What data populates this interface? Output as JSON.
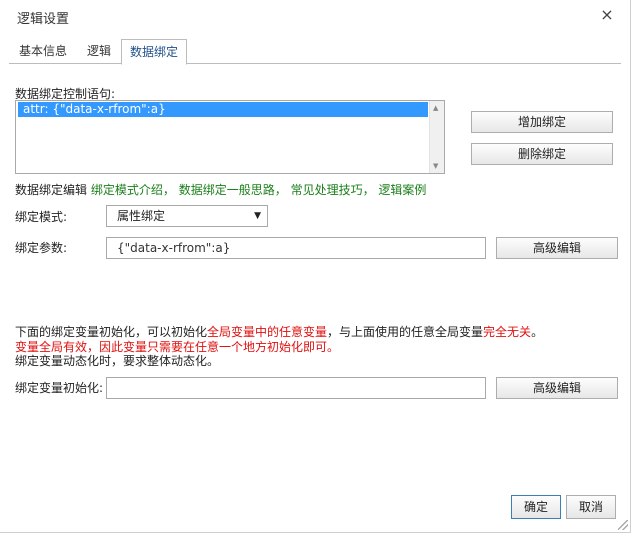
{
  "window": {
    "title": "逻辑设置",
    "close_glyph": "×"
  },
  "tabs": [
    {
      "label": "基本信息",
      "active": false
    },
    {
      "label": "逻辑",
      "active": false
    },
    {
      "label": "数据绑定",
      "active": true
    }
  ],
  "statements": {
    "label": "数据绑定控制语句:",
    "items": [
      "attr: {\"data-x-rfrom\":a}"
    ]
  },
  "buttons": {
    "add_binding": "增加绑定",
    "delete_binding": "删除绑定",
    "advanced_edit_params": "高级编辑",
    "advanced_edit_init": "高级编辑",
    "ok": "确定",
    "cancel": "取消"
  },
  "help": {
    "prefix": "数据绑定编辑",
    "links": [
      "绑定模式介绍",
      "数据绑定一般思路",
      "常见处理技巧",
      "逻辑案例"
    ],
    "sep": "，"
  },
  "mode": {
    "label": "绑定模式:",
    "value": "属性绑定"
  },
  "params": {
    "label": "绑定参数:",
    "value": "{\"data-x-rfrom\":a}"
  },
  "notes": {
    "line1_a": "下面的绑定变量初始化，可以初始化",
    "line1_b": "全局变量中的任意变量",
    "line1_c": "，与上面使用的任意全局变量",
    "line1_d": "完全无关",
    "line1_e": "。",
    "line2_a": "变量",
    "line2_b": "全局有效",
    "line2_c": "，因此变量只需要在任意一个地方初始化即可。",
    "line3": "绑定变量动态化时，要求整体动态化。"
  },
  "init": {
    "label": "绑定变量初始化:",
    "value": ""
  },
  "colors": {
    "link": "#1a7f1a",
    "warn": "#e01010",
    "selection": "#3399ff"
  }
}
